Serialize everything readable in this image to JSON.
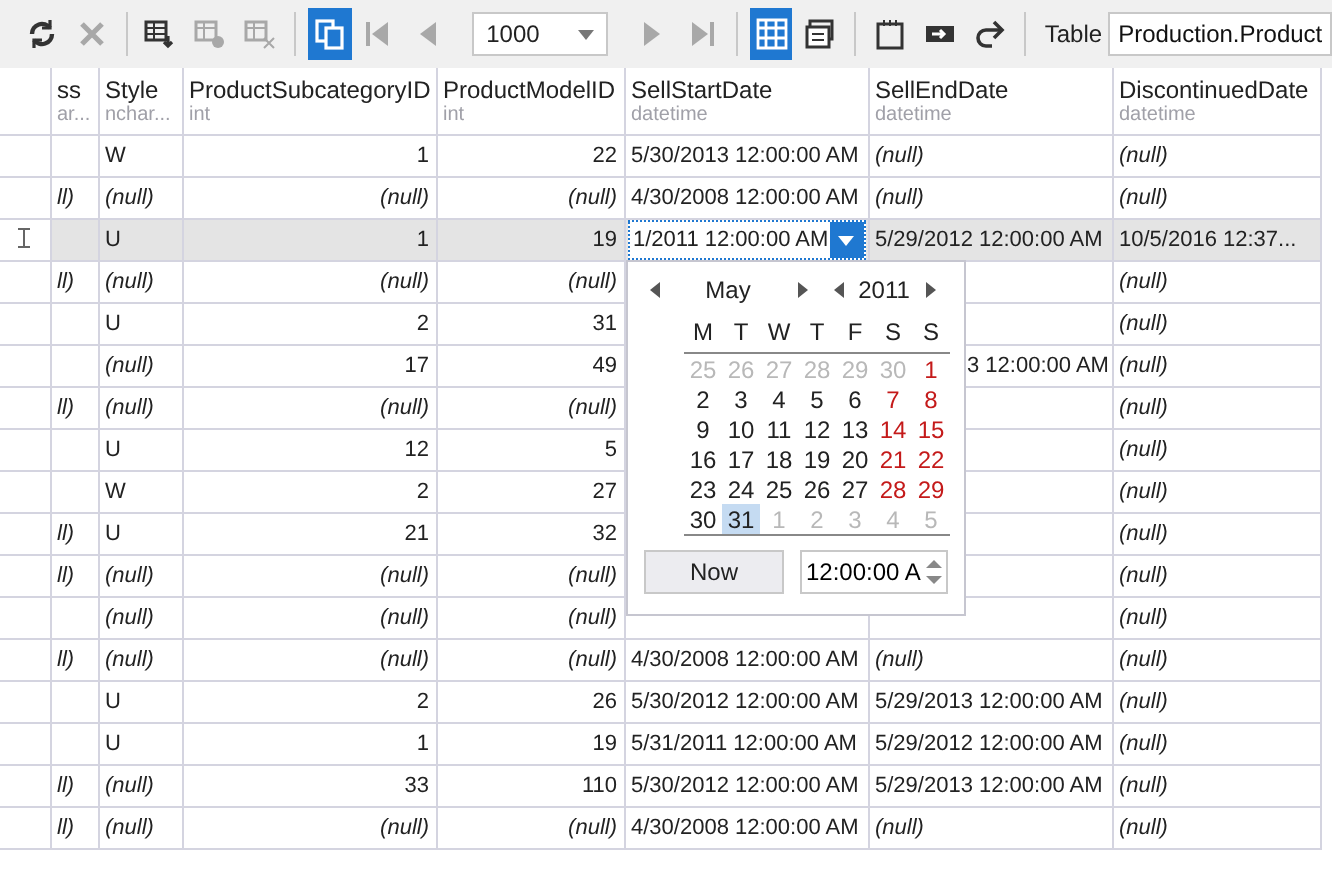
{
  "toolbar": {
    "buttons": [
      {
        "disabled": false,
        "active": false
      },
      {
        "disabled": true,
        "active": false
      },
      {
        "disabled": false,
        "active": false
      },
      {
        "disabled": true,
        "active": false
      },
      {
        "disabled": true,
        "active": false
      },
      {
        "disabled": false,
        "active": true
      },
      {
        "disabled": true,
        "active": false
      },
      {
        "disabled": true,
        "active": false
      }
    ],
    "page_size": "1000",
    "nav_buttons": [
      {
        "disabled": true,
        "active": false
      },
      {
        "disabled": true,
        "active": false
      },
      {
        "disabled": false,
        "active": true
      },
      {
        "disabled": false,
        "active": false
      },
      {
        "disabled": false,
        "active": false
      },
      {
        "disabled": false,
        "active": false
      },
      {
        "disabled": false,
        "active": false
      }
    ],
    "table_label": "Table",
    "table_value": "Production.Product"
  },
  "table": {
    "columns": [
      {
        "name": "ss",
        "type": "ar...",
        "kind": "text"
      },
      {
        "name": "Style",
        "type": "nchar...",
        "kind": "text"
      },
      {
        "name": "ProductSubcategoryID",
        "type": "int",
        "kind": "number"
      },
      {
        "name": "ProductModelID",
        "type": "int",
        "kind": "number"
      },
      {
        "name": "SellStartDate",
        "type": "datetime",
        "kind": "text"
      },
      {
        "name": "SellEndDate",
        "type": "datetime",
        "kind": "text"
      },
      {
        "name": "DiscontinuedDate",
        "type": "datetime",
        "kind": "text"
      }
    ],
    "rows": [
      {
        "selected": false,
        "cells": [
          null,
          "W",
          "1",
          "22",
          "5/30/2013 12:00:00 AM",
          {
            "null": "(null)"
          },
          {
            "null": "(null)"
          }
        ]
      },
      {
        "selected": false,
        "cells": [
          {
            "null": "ll)"
          },
          {
            "null": "(null)"
          },
          {
            "null": "(null)"
          },
          {
            "null": "(null)"
          },
          "4/30/2008 12:00:00 AM",
          {
            "null": "(null)"
          },
          {
            "null": "(null)"
          }
        ]
      },
      {
        "selected": true,
        "cursor": true,
        "cells": [
          null,
          "U",
          "1",
          "19",
          {
            "editor": "1/2011 12:00:00 AM"
          },
          "5/29/2012 12:00:00 AM",
          "10/5/2016 12:37..."
        ]
      },
      {
        "selected": false,
        "cells": [
          {
            "null": "ll)"
          },
          {
            "null": "(null)"
          },
          {
            "null": "(null)"
          },
          {
            "null": "(null)"
          },
          null,
          null,
          {
            "null": "(null)"
          }
        ]
      },
      {
        "selected": false,
        "cells": [
          null,
          "U",
          "2",
          "31",
          null,
          null,
          {
            "null": "(null)"
          }
        ]
      },
      {
        "selected": false,
        "cells": [
          null,
          {
            "null": "(null)"
          },
          "17",
          "49",
          null,
          {
            "cut": "3 12:00:00 AM"
          },
          {
            "null": "(null)"
          }
        ]
      },
      {
        "selected": false,
        "cells": [
          {
            "null": "ll)"
          },
          {
            "null": "(null)"
          },
          {
            "null": "(null)"
          },
          {
            "null": "(null)"
          },
          null,
          null,
          {
            "null": "(null)"
          }
        ]
      },
      {
        "selected": false,
        "cells": [
          null,
          "U",
          "12",
          "5",
          null,
          null,
          {
            "null": "(null)"
          }
        ]
      },
      {
        "selected": false,
        "cells": [
          null,
          "W",
          "2",
          "27",
          null,
          null,
          {
            "null": "(null)"
          }
        ]
      },
      {
        "selected": false,
        "cells": [
          {
            "null": "ll)"
          },
          "U",
          "21",
          "32",
          null,
          null,
          {
            "null": "(null)"
          }
        ]
      },
      {
        "selected": false,
        "cells": [
          {
            "null": "ll)"
          },
          {
            "null": "(null)"
          },
          {
            "null": "(null)"
          },
          {
            "null": "(null)"
          },
          null,
          null,
          {
            "null": "(null)"
          }
        ]
      },
      {
        "selected": false,
        "cells": [
          null,
          {
            "null": "(null)"
          },
          {
            "null": "(null)"
          },
          {
            "null": "(null)"
          },
          null,
          null,
          {
            "null": "(null)"
          }
        ]
      },
      {
        "selected": false,
        "cells": [
          {
            "null": "ll)"
          },
          {
            "null": "(null)"
          },
          {
            "null": "(null)"
          },
          {
            "null": "(null)"
          },
          "4/30/2008 12:00:00 AM",
          {
            "null": "(null)"
          },
          {
            "null": "(null)"
          }
        ]
      },
      {
        "selected": false,
        "cells": [
          null,
          "U",
          "2",
          "26",
          "5/30/2012 12:00:00 AM",
          "5/29/2013 12:00:00 AM",
          {
            "null": "(null)"
          }
        ]
      },
      {
        "selected": false,
        "cells": [
          null,
          "U",
          "1",
          "19",
          "5/31/2011 12:00:00 AM",
          "5/29/2012 12:00:00 AM",
          {
            "null": "(null)"
          }
        ]
      },
      {
        "selected": false,
        "cells": [
          {
            "null": "ll)"
          },
          {
            "null": "(null)"
          },
          "33",
          "110",
          "5/30/2012 12:00:00 AM",
          "5/29/2013 12:00:00 AM",
          {
            "null": "(null)"
          }
        ]
      },
      {
        "selected": false,
        "cells": [
          {
            "null": "ll)"
          },
          {
            "null": "(null)"
          },
          {
            "null": "(null)"
          },
          {
            "null": "(null)"
          },
          "4/30/2008 12:00:00 AM",
          {
            "null": "(null)"
          },
          {
            "null": "(null)"
          }
        ]
      }
    ]
  },
  "calendar": {
    "month": "May",
    "year": "2011",
    "weekdays": [
      "M",
      "T",
      "W",
      "T",
      "F",
      "S",
      "S"
    ],
    "days": [
      {
        "d": "25",
        "other": true,
        "selected": false
      },
      {
        "d": "26",
        "other": true,
        "selected": false
      },
      {
        "d": "27",
        "other": true,
        "selected": false
      },
      {
        "d": "28",
        "other": true,
        "selected": false
      },
      {
        "d": "29",
        "other": true,
        "selected": false
      },
      {
        "d": "30",
        "other": true,
        "selected": false
      },
      {
        "d": "1",
        "other": false,
        "selected": false
      },
      {
        "d": "2",
        "other": false,
        "selected": false
      },
      {
        "d": "3",
        "other": false,
        "selected": false
      },
      {
        "d": "4",
        "other": false,
        "selected": false
      },
      {
        "d": "5",
        "other": false,
        "selected": false
      },
      {
        "d": "6",
        "other": false,
        "selected": false
      },
      {
        "d": "7",
        "other": false,
        "selected": false
      },
      {
        "d": "8",
        "other": false,
        "selected": false
      },
      {
        "d": "9",
        "other": false,
        "selected": false
      },
      {
        "d": "10",
        "other": false,
        "selected": false
      },
      {
        "d": "11",
        "other": false,
        "selected": false
      },
      {
        "d": "12",
        "other": false,
        "selected": false
      },
      {
        "d": "13",
        "other": false,
        "selected": false
      },
      {
        "d": "14",
        "other": false,
        "selected": false
      },
      {
        "d": "15",
        "other": false,
        "selected": false
      },
      {
        "d": "16",
        "other": false,
        "selected": false
      },
      {
        "d": "17",
        "other": false,
        "selected": false
      },
      {
        "d": "18",
        "other": false,
        "selected": false
      },
      {
        "d": "19",
        "other": false,
        "selected": false
      },
      {
        "d": "20",
        "other": false,
        "selected": false
      },
      {
        "d": "21",
        "other": false,
        "selected": false
      },
      {
        "d": "22",
        "other": false,
        "selected": false
      },
      {
        "d": "23",
        "other": false,
        "selected": false
      },
      {
        "d": "24",
        "other": false,
        "selected": false
      },
      {
        "d": "25",
        "other": false,
        "selected": false
      },
      {
        "d": "26",
        "other": false,
        "selected": false
      },
      {
        "d": "27",
        "other": false,
        "selected": false
      },
      {
        "d": "28",
        "other": false,
        "selected": false
      },
      {
        "d": "29",
        "other": false,
        "selected": false
      },
      {
        "d": "30",
        "other": false,
        "selected": false
      },
      {
        "d": "31",
        "other": false,
        "selected": true
      },
      {
        "d": "1",
        "other": true,
        "selected": false
      },
      {
        "d": "2",
        "other": true,
        "selected": false
      },
      {
        "d": "3",
        "other": true,
        "selected": false
      },
      {
        "d": "4",
        "other": true,
        "selected": false
      },
      {
        "d": "5",
        "other": true,
        "selected": false
      }
    ],
    "now_button": "Now",
    "time": "12:00:00 A"
  }
}
